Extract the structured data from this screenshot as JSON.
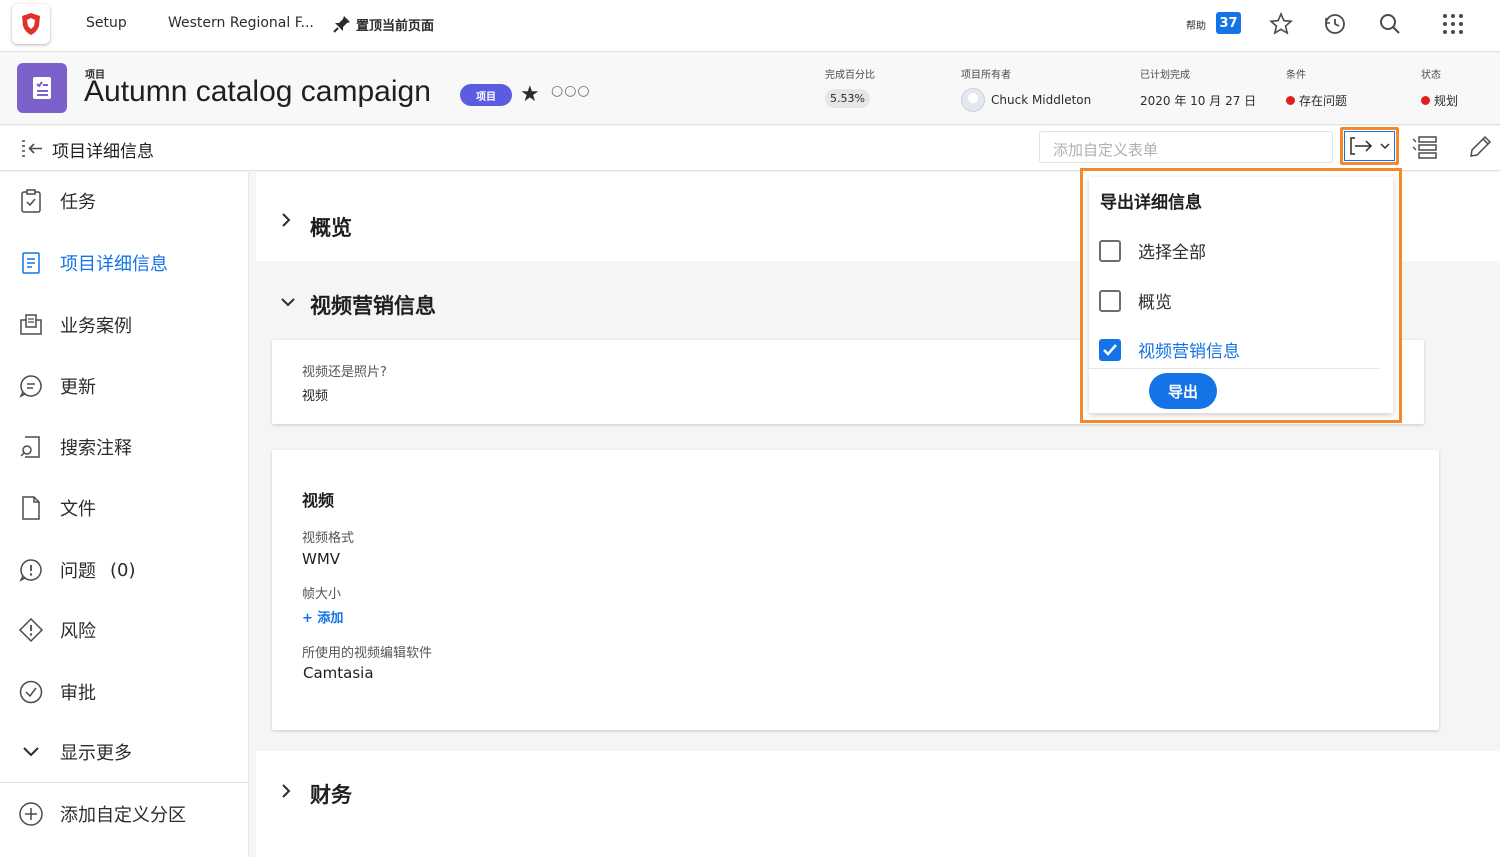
{
  "topnav": {
    "setup": "Setup",
    "breadcrumb": "Western Regional F...",
    "pin_label": "置顶当前页面",
    "help_label": "帮助",
    "help_count": "37"
  },
  "header": {
    "type_label": "项目",
    "title": "Autumn catalog campaign",
    "badge": "项目",
    "more": "○○○",
    "percent_label": "完成百分比",
    "percent_value": "5.53%",
    "owner_label": "项目所有者",
    "owner_value": "Chuck Middleton",
    "planned_label": "已计划完成",
    "planned_value": "2020 年 10 月 27 日",
    "condition_label": "条件",
    "condition_value": "存在问题",
    "status_label": "状态",
    "status_value": "规划"
  },
  "subheader": {
    "title": "项目详细信息",
    "custom_form_placeholder": "添加自定义表单"
  },
  "sidebar": {
    "items": [
      {
        "label": "任务"
      },
      {
        "label": "项目详细信息"
      },
      {
        "label": "业务案例"
      },
      {
        "label": "更新"
      },
      {
        "label": "搜索注释"
      },
      {
        "label": "文件"
      },
      {
        "label": "问题",
        "count": "(0)"
      },
      {
        "label": "风险"
      },
      {
        "label": "审批"
      },
      {
        "label": "显示更多"
      },
      {
        "label": "添加自定义分区"
      }
    ]
  },
  "main": {
    "overview_label": "概览",
    "video_section_label": "视频营销信息",
    "q_label": "视频还是照片?",
    "q_value": "视频",
    "video_card_title": "视频",
    "format_label": "视频格式",
    "format_value": "WMV",
    "frame_label": "帧大小",
    "frame_add": "+ 添加",
    "software_label": "所使用的视频编辑软件",
    "software_value": "Camtasia",
    "finance_label": "财务"
  },
  "export_dropdown": {
    "title": "导出详细信息",
    "select_all": "选择全部",
    "overview": "概览",
    "video_marketing": "视频营销信息",
    "export_button": "导出"
  },
  "colors": {
    "accent": "#1473e6",
    "highlight": "#f5882a",
    "project_icon": "#7b61c9",
    "badge": "#5c5ce0",
    "alert": "#e02020"
  }
}
